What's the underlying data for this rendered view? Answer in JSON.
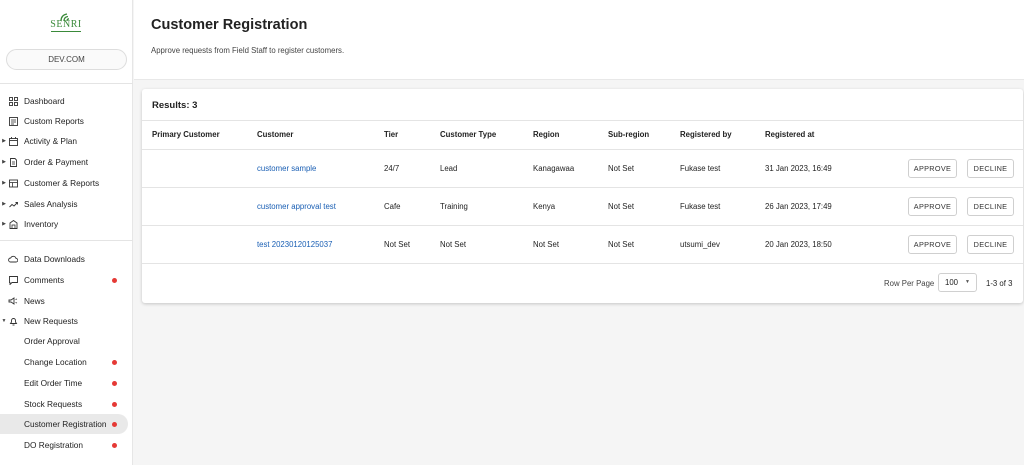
{
  "app": {
    "logo_text": "SENRI",
    "domain": "DEV.COM"
  },
  "sidebar": {
    "items": [
      {
        "label": "Dashboard",
        "icon": "grid-icon"
      },
      {
        "label": "Custom Reports",
        "icon": "report-icon"
      },
      {
        "label": "Activity & Plan",
        "icon": "calendar-icon"
      },
      {
        "label": "Order & Payment",
        "icon": "document-icon"
      },
      {
        "label": "Customer & Reports",
        "icon": "table-icon"
      },
      {
        "label": "Sales Analysis",
        "icon": "trend-icon"
      },
      {
        "label": "Inventory",
        "icon": "inventory-icon"
      }
    ],
    "items2": [
      {
        "label": "Data Downloads",
        "icon": "cloud-icon"
      },
      {
        "label": "Comments",
        "icon": "comment-icon"
      },
      {
        "label": "News",
        "icon": "megaphone-icon"
      },
      {
        "label": "New Requests",
        "icon": "bell-icon"
      }
    ],
    "subitems": [
      {
        "label": "Order Approval"
      },
      {
        "label": "Change Location"
      },
      {
        "label": "Edit Order Time"
      },
      {
        "label": "Stock Requests"
      },
      {
        "label": "Customer Registration"
      },
      {
        "label": "DO Registration"
      }
    ],
    "badge_color": "#e53935"
  },
  "header": {
    "title": "Customer Registration",
    "subtitle": "Approve requests from Field Staff to register customers."
  },
  "table": {
    "results_label": "Results: 3",
    "columns": [
      "Primary Customer",
      "Customer",
      "Tier",
      "Customer Type",
      "Region",
      "Sub-region",
      "Registered by",
      "Registered at"
    ],
    "rows": [
      {
        "primary": "",
        "customer": "customer sample",
        "tier": "24/7",
        "type": "Lead",
        "region": "Kanagawaa",
        "subregion": "Not Set",
        "by": "Fukase test",
        "at": "31 Jan 2023, 16:49"
      },
      {
        "primary": "",
        "customer": "customer approval test",
        "tier": "Cafe",
        "type": "Training",
        "region": "Kenya",
        "subregion": "Not Set",
        "by": "Fukase test",
        "at": "26 Jan 2023, 17:49"
      },
      {
        "primary": "",
        "customer": "test 20230120125037",
        "tier": "Not Set",
        "type": "Not Set",
        "region": "Not Set",
        "subregion": "Not Set",
        "by": "utsumi_dev",
        "at": "20 Jan 2023, 18:50"
      }
    ],
    "approve_label": "APPROVE",
    "decline_label": "DECLINE"
  },
  "pagination": {
    "rows_per_page_label": "Row Per Page",
    "rows_per_page_value": "100",
    "range": "1-3 of 3"
  }
}
